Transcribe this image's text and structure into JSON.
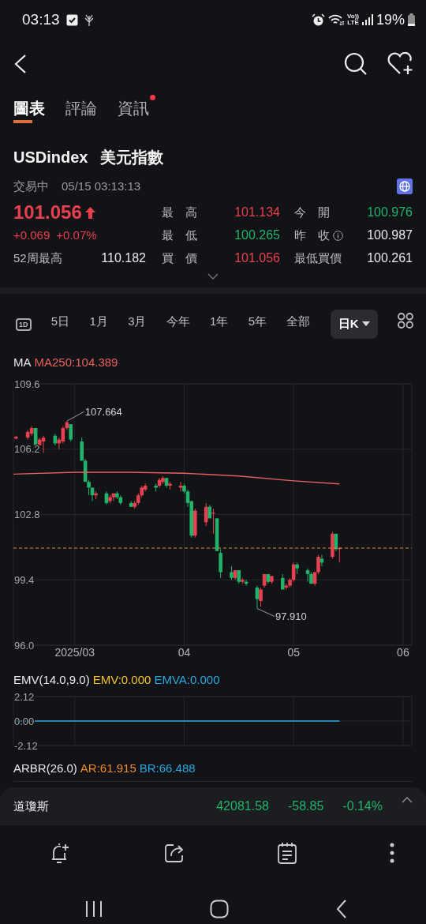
{
  "status_bar": {
    "time": "03:13",
    "volte": "Vo))",
    "lte": "LTE",
    "battery": "19%"
  },
  "tabs": [
    {
      "label": "圖表",
      "selected": true,
      "dot": false
    },
    {
      "label": "評論",
      "selected": false,
      "dot": false
    },
    {
      "label": "資訊",
      "selected": false,
      "dot": true
    }
  ],
  "instrument": {
    "symbol": "USDindex",
    "name": "美元指數",
    "state": "交易中",
    "datetime": "05/15 03:13:13"
  },
  "quote": {
    "price": "101.056",
    "change": "+0.069",
    "change_pct": "+0.07%",
    "color": "#e8404f"
  },
  "high_52w": {
    "label": "52周最高",
    "value": "110.182"
  },
  "stats": [
    {
      "label": "最　高",
      "value": "101.134",
      "color": "#e8404f",
      "info": false
    },
    {
      "label": "今　開",
      "value": "100.976",
      "color": "#21b36b",
      "info": false
    },
    {
      "label": "最　低",
      "value": "100.265",
      "color": "#21b36b",
      "info": false
    },
    {
      "label": "昨　收",
      "value": "100.987",
      "color": "#e8e8e8",
      "info": true
    },
    {
      "label": "買　價",
      "value": "101.056",
      "color": "#e8404f",
      "info": false
    },
    {
      "label": "最低買價",
      "value": "100.261",
      "color": "#e8e8e8",
      "info": false
    }
  ],
  "periods": [
    {
      "label": "1D",
      "kind": "boxed",
      "selected": false
    },
    {
      "label": "5日",
      "kind": "text",
      "selected": false
    },
    {
      "label": "1月",
      "kind": "text",
      "selected": false
    },
    {
      "label": "3月",
      "kind": "text",
      "selected": false
    },
    {
      "label": "今年",
      "kind": "text",
      "selected": false
    },
    {
      "label": "1年",
      "kind": "text",
      "selected": false
    },
    {
      "label": "5年",
      "kind": "text",
      "selected": false
    },
    {
      "label": "全部",
      "kind": "text",
      "selected": false
    },
    {
      "label": "日K",
      "kind": "dropdown",
      "selected": true
    }
  ],
  "main_indicator": {
    "name": "MA",
    "values": [
      {
        "text": "MA250:104.389",
        "color": "#e8605e"
      }
    ]
  },
  "main_chart": {
    "chart_data": {
      "type": "candlestick",
      "grid": true,
      "xlim": [
        2.44,
        6.08
      ],
      "ylim": [
        96.0,
        109.6
      ],
      "yticks": [
        {
          "value": 109.6,
          "label": "109.6"
        },
        {
          "value": 106.2,
          "label": "106.2"
        },
        {
          "value": 102.8,
          "label": "102.8"
        },
        {
          "value": 99.4,
          "label": "99.4"
        },
        {
          "value": 96.0,
          "label": "96.0"
        }
      ],
      "xticks": [
        {
          "value": 3,
          "label": "2025/03"
        },
        {
          "value": 4,
          "label": "04"
        },
        {
          "value": 5,
          "label": "05"
        },
        {
          "value": 6,
          "label": "06"
        }
      ],
      "x": [
        2.464,
        2.571,
        2.607,
        2.643,
        2.679,
        2.714,
        2.821,
        2.857,
        2.893,
        2.929,
        2.964,
        3.065,
        3.097,
        3.129,
        3.161,
        3.194,
        3.29,
        3.323,
        3.355,
        3.387,
        3.419,
        3.516,
        3.548,
        3.581,
        3.613,
        3.645,
        3.742,
        3.774,
        3.806,
        3.839,
        3.871,
        3.968,
        4.0,
        4.033,
        4.067,
        4.1,
        4.2,
        4.233,
        4.267,
        4.3,
        4.333,
        4.433,
        4.467,
        4.5,
        4.533,
        4.567,
        4.667,
        4.7,
        4.733,
        4.767,
        4.8,
        4.9,
        4.933,
        4.967,
        5.0,
        5.032,
        5.129,
        5.161,
        5.194,
        5.226,
        5.258,
        5.355,
        5.387,
        5.419
      ],
      "ohlc": [
        [
          106.75,
          106.9,
          106.7,
          106.85
        ],
        [
          106.8,
          107.2,
          106.7,
          107.1
        ],
        [
          107.0,
          107.4,
          106.9,
          107.3
        ],
        [
          107.3,
          107.3,
          106.3,
          106.4
        ],
        [
          106.4,
          106.8,
          106.3,
          106.7
        ],
        [
          106.6,
          106.9,
          106.0,
          106.8
        ],
        [
          106.9,
          107.0,
          106.4,
          106.5
        ],
        [
          106.5,
          106.8,
          106.2,
          106.7
        ],
        [
          106.6,
          107.4,
          106.5,
          107.3
        ],
        [
          107.3,
          107.664,
          107.2,
          107.6
        ],
        [
          107.5,
          107.5,
          106.6,
          106.7
        ],
        [
          106.6,
          106.8,
          105.6,
          105.6
        ],
        [
          105.6,
          105.7,
          104.5,
          104.5
        ],
        [
          104.5,
          104.6,
          103.8,
          104.2
        ],
        [
          104.2,
          104.2,
          103.5,
          103.8
        ],
        [
          103.8,
          104.0,
          103.6,
          103.9
        ],
        [
          103.9,
          104.0,
          103.3,
          103.4
        ],
        [
          103.5,
          103.8,
          103.4,
          103.7
        ],
        [
          103.7,
          103.9,
          103.5,
          103.9
        ],
        [
          103.9,
          104.0,
          103.6,
          103.7
        ],
        [
          103.7,
          103.8,
          103.3,
          103.4
        ],
        [
          103.4,
          103.5,
          103.2,
          103.2
        ],
        [
          103.2,
          103.5,
          103.1,
          103.4
        ],
        [
          103.4,
          103.9,
          103.3,
          103.8
        ],
        [
          103.8,
          104.3,
          103.7,
          104.2
        ],
        [
          104.1,
          104.4,
          104.0,
          104.3
        ],
        [
          104.3,
          104.4,
          104.0,
          104.2
        ],
        [
          104.3,
          104.7,
          104.2,
          104.6
        ],
        [
          104.5,
          104.8,
          104.4,
          104.7
        ],
        [
          104.7,
          104.7,
          104.2,
          104.3
        ],
        [
          104.3,
          104.5,
          104.1,
          104.4
        ],
        [
          104.2,
          104.5,
          104.0,
          104.3
        ],
        [
          104.3,
          104.4,
          103.9,
          104.0
        ],
        [
          104.0,
          104.1,
          103.2,
          103.4
        ],
        [
          103.5,
          103.5,
          101.6,
          101.7
        ],
        [
          101.7,
          103.1,
          101.6,
          103.0
        ],
        [
          102.4,
          103.4,
          102.2,
          103.2
        ],
        [
          103.2,
          103.3,
          102.6,
          102.6
        ],
        [
          102.9,
          103.1,
          101.8,
          102.9
        ],
        [
          102.6,
          102.6,
          100.9,
          100.9
        ],
        [
          100.8,
          101.0,
          99.5,
          99.8
        ],
        [
          99.8,
          100.1,
          99.4,
          99.5
        ],
        [
          99.5,
          99.9,
          99.4,
          99.9
        ],
        [
          99.9,
          99.9,
          99.2,
          99.3
        ],
        [
          99.3,
          99.5,
          99.2,
          99.4
        ],
        [
          99.3,
          99.4,
          99.1,
          99.2
        ],
        [
          99.0,
          99.1,
          97.91,
          98.4
        ],
        [
          98.3,
          99.0,
          98.0,
          98.9
        ],
        [
          99.1,
          99.7,
          99.0,
          99.7
        ],
        [
          99.7,
          99.7,
          99.2,
          99.3
        ],
        [
          99.3,
          99.6,
          99.2,
          99.6
        ],
        [
          99.5,
          99.7,
          98.9,
          98.9
        ],
        [
          99.0,
          99.2,
          98.9,
          99.1
        ],
        [
          99.1,
          99.5,
          99.0,
          99.4
        ],
        [
          99.4,
          100.3,
          99.3,
          100.2
        ],
        [
          100.2,
          100.3,
          99.7,
          100.0
        ],
        [
          99.9,
          100.0,
          99.3,
          99.7
        ],
        [
          99.7,
          99.8,
          99.2,
          99.2
        ],
        [
          99.2,
          99.8,
          99.1,
          99.8
        ],
        [
          99.8,
          100.7,
          99.7,
          100.6
        ],
        [
          100.5,
          100.7,
          100.1,
          100.3
        ],
        [
          100.6,
          101.9,
          100.5,
          101.8
        ],
        [
          101.8,
          101.8,
          100.9,
          101.0
        ],
        [
          101.0,
          101.1,
          100.3,
          101.056
        ]
      ],
      "annotations": [
        {
          "x": 2.929,
          "y": 107.664,
          "text": "107.664"
        },
        {
          "x": 4.667,
          "y": 97.91,
          "text": "97.910"
        }
      ]
    }
  },
  "emv_indicator": {
    "name": "EMV(14.0,9.0)",
    "values": [
      {
        "text": "EMV:0.000",
        "color": "#f2c12e"
      },
      {
        "text": "EMVA:0.000",
        "color": "#2aa7e0"
      }
    ]
  },
  "emv_chart": {
    "chart_data": {
      "type": "line",
      "grid": true,
      "xlim": [
        2.44,
        6.08
      ],
      "ylim": [
        -2.12,
        2.12
      ],
      "yticks": [
        {
          "value": 2.12,
          "label": "2.12"
        },
        {
          "value": 0,
          "label": "0.00"
        },
        {
          "value": -2.12,
          "label": "-2.12"
        }
      ],
      "x": [
        2.464,
        5.419
      ],
      "series": [
        {
          "color": "#2aa7e0",
          "values": [
            0,
            0
          ]
        }
      ]
    }
  },
  "arbr_indicator": {
    "name": "ARBR(26.0)",
    "values": [
      {
        "text": "AR:61.915",
        "color": "#f08a2c"
      },
      {
        "text": "BR:66.488",
        "color": "#2aa7e0"
      }
    ]
  },
  "ticker": {
    "name": "道瓊斯",
    "price": "42081.58",
    "change": "-58.85",
    "change_pct": "-0.14%",
    "color": "#21b36b"
  }
}
